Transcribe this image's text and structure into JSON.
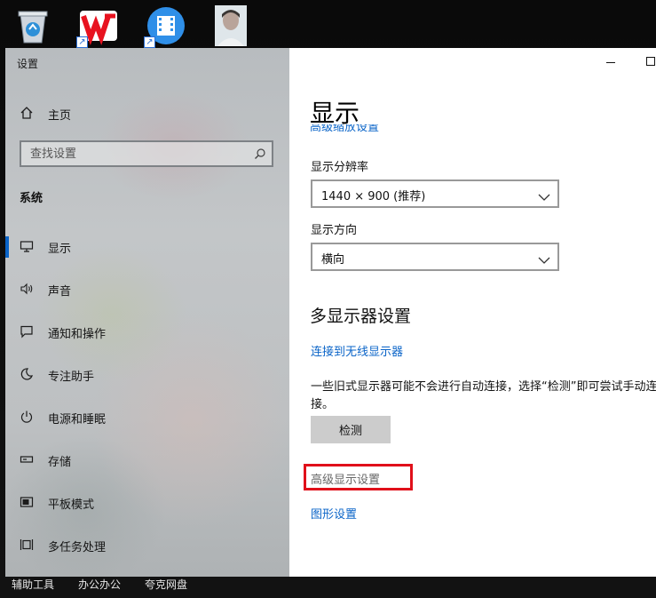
{
  "desktop": {
    "icons": [
      "recycle-bin-icon",
      "wps-office-icon",
      "video-player-icon",
      "photo-thumbnail-icon"
    ],
    "taskbar_labels": [
      "辅助工具",
      "办公办公",
      "夸克网盘"
    ]
  },
  "window": {
    "title": "设置"
  },
  "sidebar": {
    "home_label": "主页",
    "search_placeholder": "查找设置",
    "section_title": "系统",
    "items": [
      {
        "label": "显示",
        "icon": "monitor-icon",
        "active": true
      },
      {
        "label": "声音",
        "icon": "speaker-icon"
      },
      {
        "label": "通知和操作",
        "icon": "notification-icon"
      },
      {
        "label": "专注助手",
        "icon": "moon-icon"
      },
      {
        "label": "电源和睡眠",
        "icon": "power-icon"
      },
      {
        "label": "存储",
        "icon": "storage-icon"
      },
      {
        "label": "平板模式",
        "icon": "tablet-icon"
      },
      {
        "label": "多任务处理",
        "icon": "multitasking-icon"
      }
    ]
  },
  "content": {
    "page_title": "显示",
    "cut_link": "高级缩放设置",
    "resolution_label": "显示分辨率",
    "resolution_value": "1440 × 900 (推荐)",
    "orientation_label": "显示方向",
    "orientation_value": "横向",
    "multi_display_title": "多显示器设置",
    "wireless_link": "连接到无线显示器",
    "description": "一些旧式显示器可能不会进行自动连接，选择“检测”即可尝试手动连接。",
    "detect_button": "检测",
    "advanced_link": "高级显示设置",
    "graphics_link": "图形设置"
  },
  "colors": {
    "accent": "#0a64c8",
    "highlight": "#e0101a"
  }
}
